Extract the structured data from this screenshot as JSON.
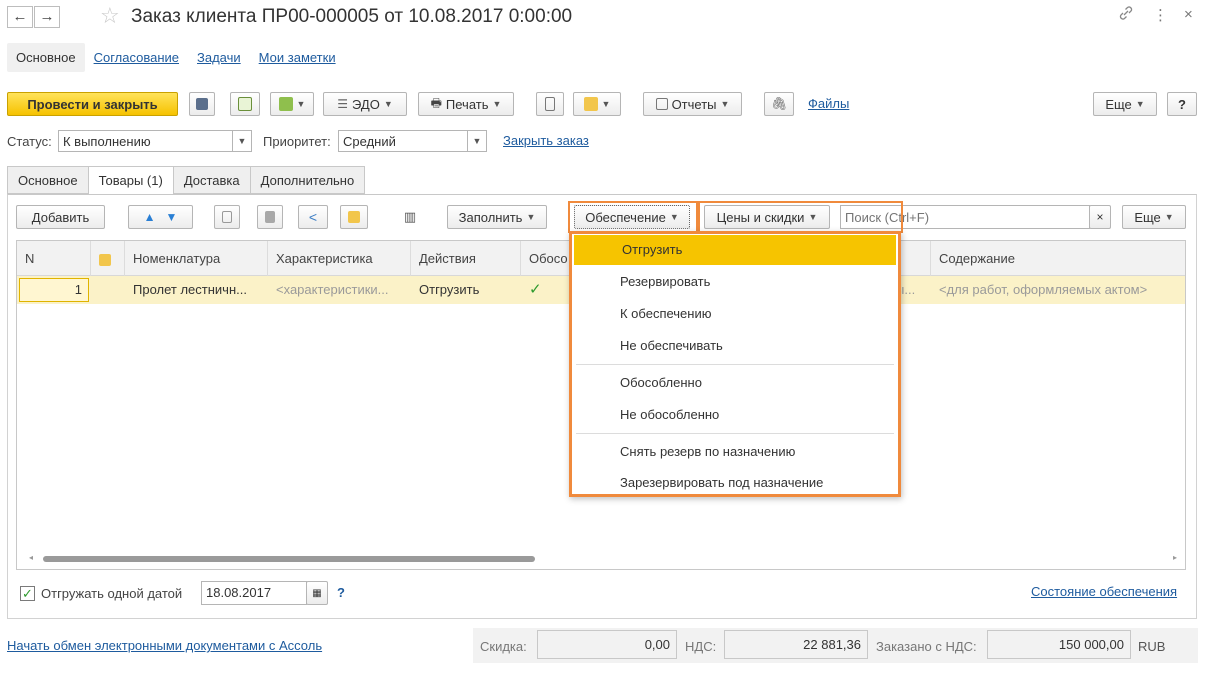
{
  "window": {
    "title": "Заказ клиента ПР00-000005 от 10.08.2017 0:00:00",
    "back_glyph": "←",
    "forward_glyph": "→",
    "star_glyph": "☆",
    "link_glyph": "🔗",
    "more_glyph": "⋮",
    "close_glyph": "×"
  },
  "topnav": [
    "Основное",
    "Согласование",
    "Задачи",
    "Мои заметки"
  ],
  "toolbar": {
    "post_close": "Провести и закрыть",
    "edo": "ЭДО",
    "print": "Печать",
    "reports": "Отчеты",
    "files": "Файлы",
    "more": "Еще",
    "help": "?"
  },
  "status": {
    "status_label": "Статус:",
    "status_value": "К выполнению",
    "priority_label": "Приоритет:",
    "priority_value": "Средний",
    "close_order": "Закрыть заказ"
  },
  "tabs": [
    "Основное",
    "Товары (1)",
    "Доставка",
    "Дополнительно"
  ],
  "goods_toolbar": {
    "add": "Добавить",
    "fill": "Заполнить",
    "provision": "Обеспечение",
    "prices": "Цены и скидки",
    "search_placeholder": "Поиск (Ctrl+F)",
    "clear": "×",
    "more": "Еще"
  },
  "table": {
    "columns": [
      "N",
      "",
      "Номенклатура",
      "Характеристика",
      "Действия",
      "Обосо",
      "Содержание"
    ],
    "rows": [
      {
        "n": "1",
        "nomenclature": "Пролет лестничн...",
        "characteristic": "<характеристики...",
        "action": "Отгрузить",
        "separate": "✓",
        "hidden": "ы...",
        "content": "<для работ, оформляемых актом>"
      }
    ]
  },
  "dropdown": {
    "items": [
      "Отгрузить",
      "Резервировать",
      "К обеспечению",
      "Не обеспечивать",
      "Обособленно",
      "Не обособленно",
      "Снять резерв по назначению",
      "Зарезервировать под назначение"
    ]
  },
  "footer": {
    "ship_one_date_label": "Отгружать одной датой",
    "ship_date": "18.08.2017",
    "help": "?",
    "provision_state": "Состояние обеспечения",
    "edo_link": "Начать обмен электронными документами с Ассоль",
    "discount_label": "Скидка:",
    "discount": "0,00",
    "vat_label": "НДС:",
    "vat": "22 881,36",
    "ordered_label": "Заказано с НДС:",
    "ordered": "150 000,00",
    "currency": "RUB"
  },
  "colors": {
    "accent": "#f6c200",
    "highlight_frame": "#f08a3c",
    "link": "#1e5b9e",
    "selected_row": "#fbf2c8"
  }
}
